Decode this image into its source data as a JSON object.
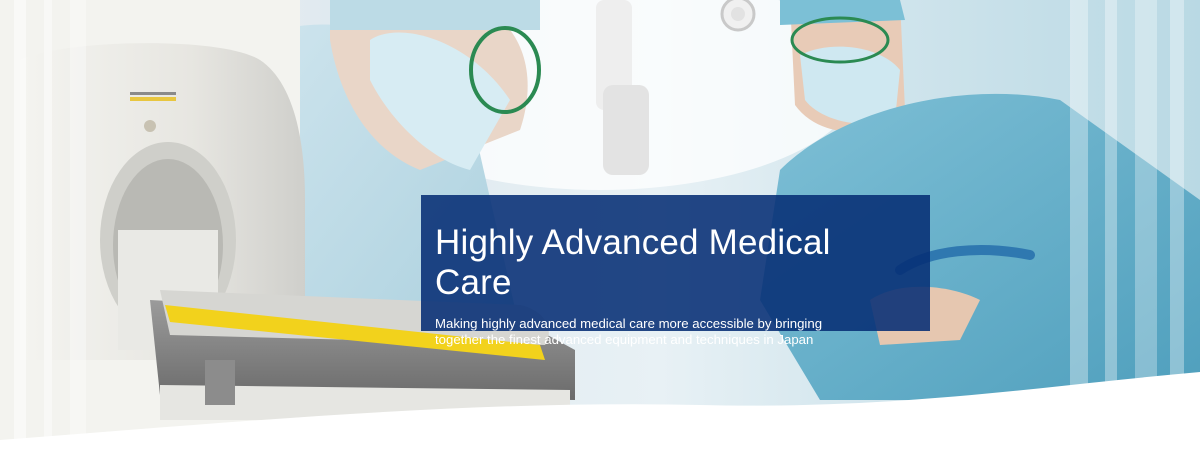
{
  "banner": {
    "title": "Highly Advanced Medical Care",
    "subtitle_line1": "Making highly advanced medical care more accessible by bringing",
    "subtitle_line2": "together the finest advanced equipment and techniques in Japan"
  },
  "colors": {
    "caption_background": "#062e74",
    "caption_text": "#ffffff",
    "scrub_blue": "#6fb6cf",
    "table_yellow": "#f2d21c"
  },
  "photo": {
    "subject": "surgeons in scrubs beside a Gamma Knife radiosurgery unit with patient couch"
  }
}
